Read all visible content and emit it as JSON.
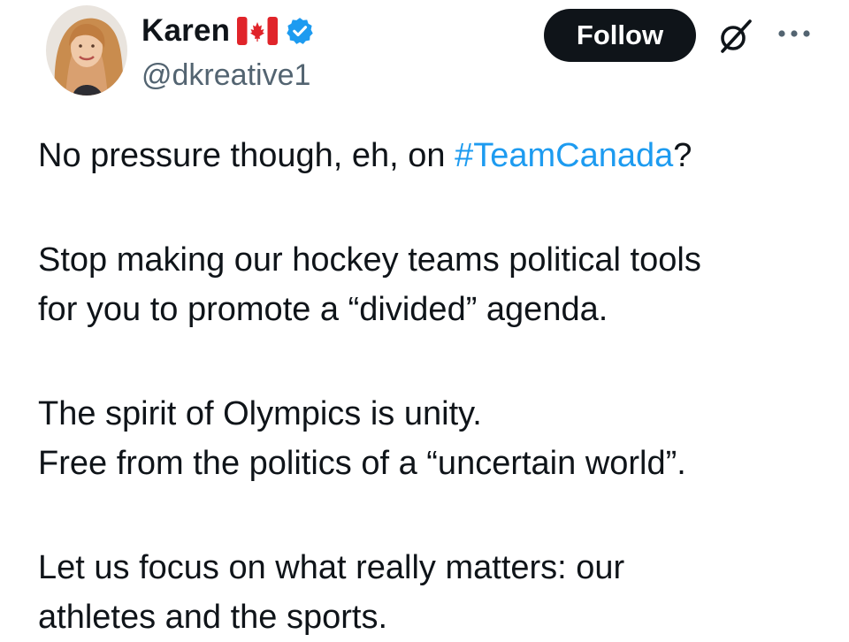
{
  "author": {
    "display_name": "Karen",
    "handle": "@dkreative1",
    "flag_icon": "canada-flag-icon",
    "verified_icon": "verified-badge-icon",
    "verified_color": "#1d9bf0"
  },
  "actions": {
    "follow_label": "Follow",
    "grok_icon": "grok-icon",
    "more_icon": "more-options-icon"
  },
  "tweet": {
    "line1_before": "No pressure though, eh, on ",
    "line1_hashtag": "#TeamCanada",
    "line1_after": "?",
    "para2_line1": "Stop making our hockey teams political tools",
    "para2_line2": "for you to promote a “divided” agenda.",
    "para3_line1": "The spirit of Olympics is unity.",
    "para3_line2": "Free from the politics of a “uncertain world”.",
    "para4_line1": "Let us focus on what really matters: our",
    "para4_line2": "athletes and the sports."
  },
  "colors": {
    "text": "#0f1419",
    "secondary": "#536471",
    "link": "#1d9bf0",
    "button_bg": "#0f1419",
    "button_text": "#ffffff"
  }
}
